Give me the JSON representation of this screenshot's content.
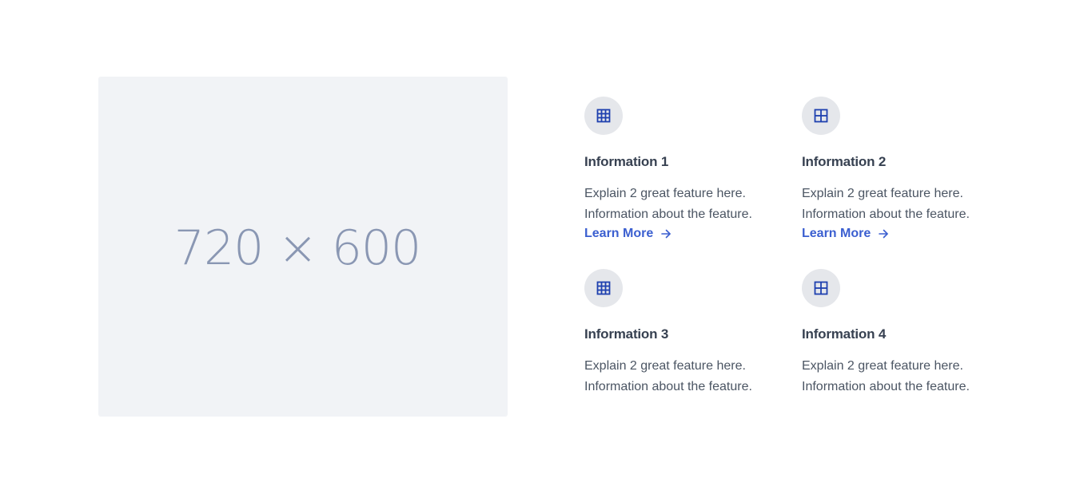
{
  "placeholder": {
    "text": "720 × 600",
    "background": "#f1f3f6",
    "text_color": "#8a97b3"
  },
  "colors": {
    "accent": "#3b5fd0",
    "icon": "#1e40af",
    "icon_bg": "#e5e7eb",
    "title": "#374151",
    "body": "#4b5563"
  },
  "features": [
    {
      "icon": "table-grid-icon",
      "title": "Information 1",
      "desc_line1": "Explain 2 great feature here.",
      "desc_line2": "Information about the feature.",
      "link": "Learn More"
    },
    {
      "icon": "window-grid-icon",
      "title": "Information 2",
      "desc_line1": "Explain 2 great feature here.",
      "desc_line2": "Information about the feature.",
      "link": "Learn More"
    },
    {
      "icon": "table-grid-icon",
      "title": "Information 3",
      "desc_line1": "Explain 2 great feature here.",
      "desc_line2": "Information about the feature."
    },
    {
      "icon": "window-grid-icon",
      "title": "Information 4",
      "desc_line1": "Explain 2 great feature here.",
      "desc_line2": "Information about the feature."
    }
  ]
}
